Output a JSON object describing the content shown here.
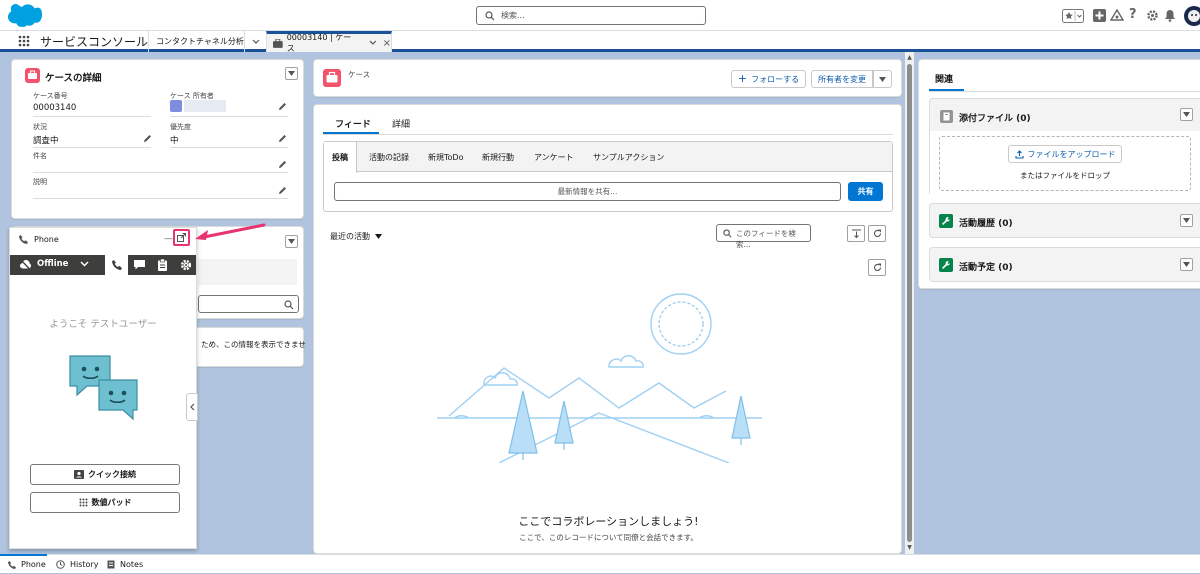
{
  "header": {
    "search_placeholder": "検索...",
    "icons": [
      "favorites-icon",
      "add-icon",
      "trailhead-icon",
      "help-icon",
      "setup-icon",
      "notifications-icon",
      "avatar"
    ]
  },
  "nav": {
    "app_name": "サービスコンソール",
    "tab1": "コンタクトチャネル分析",
    "tab2": "00003140 | ケース"
  },
  "case_detail": {
    "title": "ケースの詳細",
    "fields": {
      "case_number_label": "ケース番号",
      "case_number": "00003140",
      "owner_label": "ケース 所有者",
      "status_label": "状況",
      "status": "調査中",
      "priority_label": "優先度",
      "priority": "中",
      "subject_label": "件名",
      "description_label": "説明"
    }
  },
  "behind_phone": {
    "partial_text": "ため、この情報を表示できませ"
  },
  "phone": {
    "title": "Phone",
    "status": "Offline",
    "welcome": "ようこそ テストユーザー",
    "quick_connect": "クイック接続",
    "dialpad": "数値パッド"
  },
  "case_header": {
    "label": "ケース",
    "follow": "フォローする",
    "change_owner": "所有者を変更"
  },
  "feed": {
    "tabs": [
      "フィード",
      "詳細"
    ],
    "publisher_tabs": [
      "投稿",
      "活動の記録",
      "新規ToDo",
      "新規行動",
      "アンケート",
      "サンプルアクション"
    ],
    "share_placeholder": "最新情報を共有...",
    "share_button": "共有",
    "sort": "最近の活動",
    "search_placeholder": "このフィードを検索...",
    "empty_title": "ここでコラボレーションしましょう!",
    "empty_sub": "ここで、このレコードについて同僚と会話できます。"
  },
  "related": {
    "tab": "関連",
    "attachments": "添付ファイル (0)",
    "upload": "ファイルをアップロード",
    "drop": "またはファイルをドロップ",
    "history": "活動履歴 (0)",
    "upcoming": "活動予定 (0)"
  },
  "footer": {
    "tabs": [
      "Phone",
      "History",
      "Notes"
    ]
  },
  "colors": {
    "brand": "#0176d3",
    "case_icon": "#f2536d",
    "activity_icon": "#04844b",
    "highlight": "#e8336e"
  }
}
